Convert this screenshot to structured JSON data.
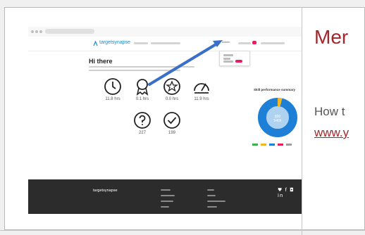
{
  "article": {
    "title": "Mer",
    "subtitle": "How t",
    "link": "www.y"
  },
  "embedded_page": {
    "logo": "targetsynapse",
    "nav_user": "Admin",
    "greeting": "Hi there",
    "stats": [
      {
        "icon": "clock-icon",
        "value": "11.8 hrs"
      },
      {
        "icon": "award-icon",
        "value": "0.1 hrs"
      },
      {
        "icon": "star-badge-icon",
        "value": "0.0 hrs"
      },
      {
        "icon": "gauge-icon",
        "value": "11.9 hrs"
      },
      {
        "icon": "question-icon",
        "value": "227"
      },
      {
        "icon": "checkmark-icon",
        "value": "199"
      }
    ],
    "donut": {
      "title": "Skill performance summary",
      "center_top": "820",
      "center_bottom": "5406",
      "colors": [
        "#1e7fd6",
        "#f2b824",
        "#37b34a",
        "#e61e5c"
      ]
    },
    "footer_logo": "targetsynapse",
    "social_icons": "♥ f ◘ in"
  },
  "colors": {
    "accent_red": "#a2262b",
    "brand_blue": "#1a8bd1",
    "arrow_blue": "#3a6fc9"
  }
}
